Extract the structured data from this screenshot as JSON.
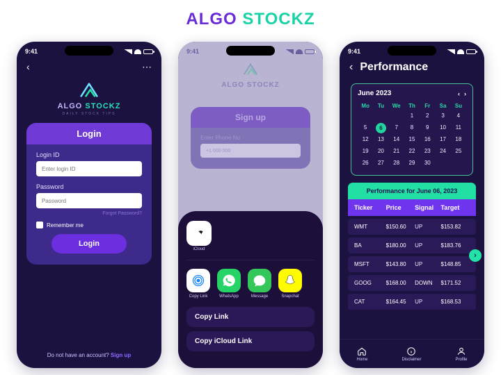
{
  "brand": {
    "part1": "ALGO",
    "part2": "STOCKZ"
  },
  "status": {
    "time": "9:41"
  },
  "logo": {
    "line1": "ALGO",
    "line2": "STOCKZ",
    "sub": "DAILY STOCK TIPS"
  },
  "login": {
    "title": "Login",
    "id_label": "Login ID",
    "id_placeholder": "Enter login ID",
    "pw_label": "Password",
    "pw_placeholder": "Password",
    "forgot": "Forgot Password?",
    "remember": "Remember me",
    "button": "Login",
    "no_account": "Do not have an account?",
    "signup": "Sign up"
  },
  "signup_faded": {
    "title": "Sign up",
    "phone_label": "Enter Phone No.",
    "phone_placeholder": "+1 000 000"
  },
  "share": {
    "icloud_label": "iCloud",
    "apps": [
      {
        "label": "Copy Link",
        "bg": "#ffffff"
      },
      {
        "label": "WhatsApp",
        "bg": "#25d366"
      },
      {
        "label": "Message",
        "bg": "#34c759"
      },
      {
        "label": "Snapchat",
        "bg": "#fffc00"
      }
    ],
    "copy_link": "Copy Link",
    "copy_icloud": "Copy iCloud Link"
  },
  "performance": {
    "title": "Performance",
    "month": "June 2023",
    "dow": [
      "Mo",
      "Tu",
      "We",
      "Th",
      "Fr",
      "Sa",
      "Su"
    ],
    "days": [
      "",
      "",
      "",
      "1",
      "2",
      "3",
      "4",
      "5",
      "6",
      "7",
      "8",
      "9",
      "10",
      "11",
      "12",
      "13",
      "14",
      "15",
      "16",
      "17",
      "18",
      "19",
      "20",
      "21",
      "22",
      "23",
      "24",
      "25",
      "26",
      "27",
      "28",
      "29",
      "30",
      "",
      ""
    ],
    "selected_day": "6",
    "band": "Performance for June 06, 2023",
    "headers": {
      "ticker": "Ticker",
      "price": "Price",
      "signal": "Signal",
      "target": "Target"
    },
    "rows": [
      {
        "ticker": "WMT",
        "price": "$150.60",
        "signal": "UP",
        "target": "$153.82"
      },
      {
        "ticker": "BA",
        "price": "$180.00",
        "signal": "UP",
        "target": "$183.76"
      },
      {
        "ticker": "MSFT",
        "price": "$143.80",
        "signal": "UP",
        "target": "$148.85"
      },
      {
        "ticker": "GOOG",
        "price": "$168.00",
        "signal": "DOWN",
        "target": "$171.52"
      },
      {
        "ticker": "CAT",
        "price": "$164.45",
        "signal": "UP",
        "target": "$168.53"
      }
    ],
    "tabs": {
      "home": "Home",
      "disclaimer": "Disclaimer",
      "profile": "Profile"
    }
  }
}
